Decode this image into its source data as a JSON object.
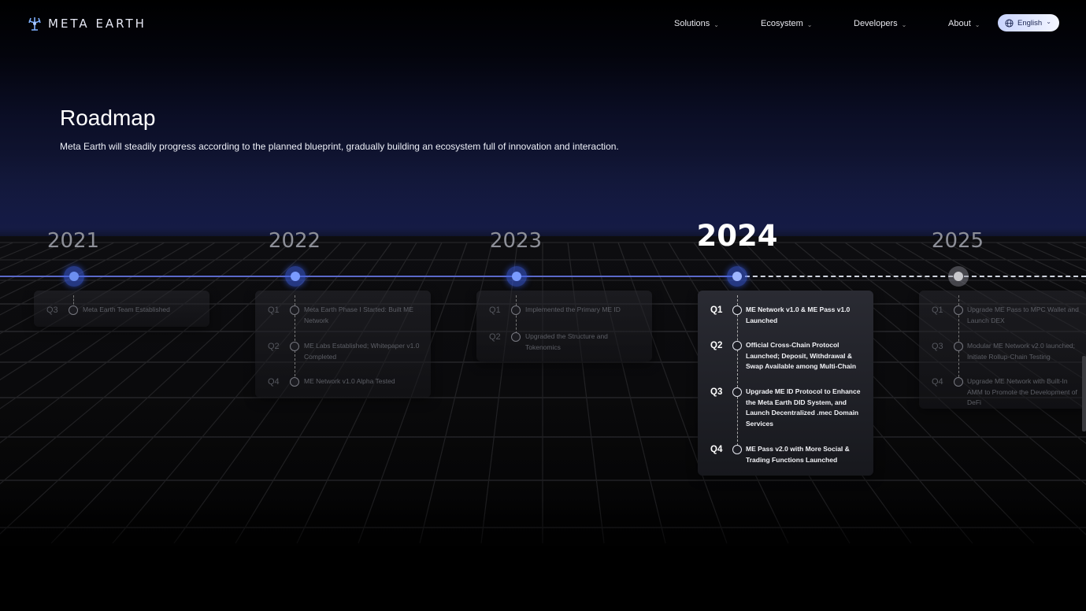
{
  "header": {
    "logo_text": "META EARTH",
    "nav": [
      {
        "label": "Solutions"
      },
      {
        "label": "Ecosystem"
      },
      {
        "label": "Developers"
      },
      {
        "label": "About"
      }
    ],
    "language": "English"
  },
  "hero": {
    "title": "Roadmap",
    "subtitle": "Meta Earth will steadily progress according to the planned blueprint, gradually building an ecosystem full of innovation and interaction."
  },
  "colors": {
    "accent": "#5a68c8",
    "node": "#7a9bff",
    "background": "#000000"
  },
  "roadmap": [
    {
      "year": "2021",
      "items": [
        {
          "quarter": "Q3",
          "text": "Meta Earth Team Established"
        }
      ]
    },
    {
      "year": "2022",
      "items": [
        {
          "quarter": "Q1",
          "text": "Meta Earth Phase I Started: Built ME Network"
        },
        {
          "quarter": "Q2",
          "text": "ME Labs Established; Whitepaper v1.0 Completed"
        },
        {
          "quarter": "Q4",
          "text": "ME Network v1.0 Alpha Tested"
        }
      ]
    },
    {
      "year": "2023",
      "items": [
        {
          "quarter": "Q1",
          "text": "Implemented the Primary ME ID"
        },
        {
          "quarter": "Q2",
          "text": "Upgraded the Structure and Tokenomics"
        }
      ]
    },
    {
      "year": "2024",
      "items": [
        {
          "quarter": "Q1",
          "text": "ME Network v1.0 & ME Pass v1.0 Launched"
        },
        {
          "quarter": "Q2",
          "text": "Official Cross-Chain Protocol Launched; Deposit, Withdrawal & Swap Available among Multi-Chain"
        },
        {
          "quarter": "Q3",
          "text": "Upgrade ME ID Protocol to Enhance the Meta Earth DID System, and Launch Decentralized .mec Domain Services"
        },
        {
          "quarter": "Q4",
          "text": "ME Pass v2.0 with More Social & Trading Functions Launched"
        }
      ]
    },
    {
      "year": "2025",
      "items": [
        {
          "quarter": "Q1",
          "text": "Upgrade ME Pass to MPC Wallet and Launch DEX"
        },
        {
          "quarter": "Q3",
          "text": "Modular ME Network v2.0 launched; Initiate Rollup-Chain Testing"
        },
        {
          "quarter": "Q4",
          "text": "Upgrade ME Network with Built-In AMM to Promote the Development of DeFi"
        }
      ]
    }
  ]
}
